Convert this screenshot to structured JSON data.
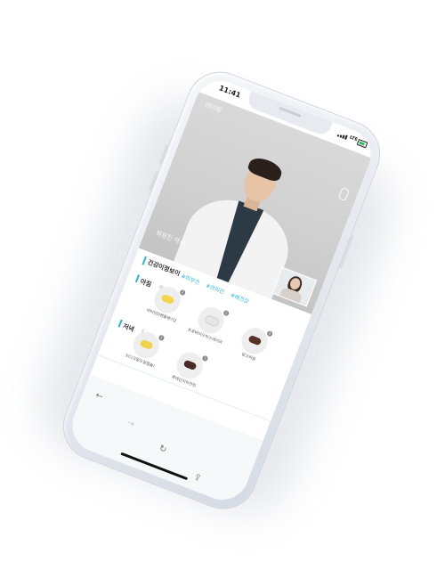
{
  "status_bar": {
    "time": "11:41",
    "network": "LTE"
  },
  "video": {
    "top_label": "에이핑",
    "doctor_name": "최원진 약사"
  },
  "health": {
    "title": "건강이정보이",
    "tags": [
      "#피부건",
      "#관리건",
      "#배건강"
    ]
  },
  "morning": {
    "title": "아침",
    "icon": "sun-icon",
    "items": [
      {
        "label": "비타민D렌틀렌기2",
        "badge": "2",
        "pill_color": "#f5d64a"
      },
      {
        "label": "프로바이오틱스데이리",
        "badge": "2",
        "pill_color": "#e6e6e6"
      },
      {
        "label": "밀크씨슬",
        "badge": "2",
        "pill_color": "#5a2f2a"
      }
    ]
  },
  "evening": {
    "title": "저녁",
    "icon": "moon-icon",
    "items": [
      {
        "label": "EC(크릴오일캡슐)",
        "badge": "1",
        "pill_color": "#f1d24a"
      },
      {
        "label": "루테인지아잔틴",
        "badge": "1",
        "pill_color": "#4a2a28"
      }
    ]
  },
  "navbar": {
    "back": "←",
    "forward": "→",
    "refresh": "↻",
    "share": "⇪"
  },
  "colors": {
    "accent": "#29b6d9",
    "phone_body": "#e7ebf0",
    "video_bg": "#d2d2d2"
  }
}
